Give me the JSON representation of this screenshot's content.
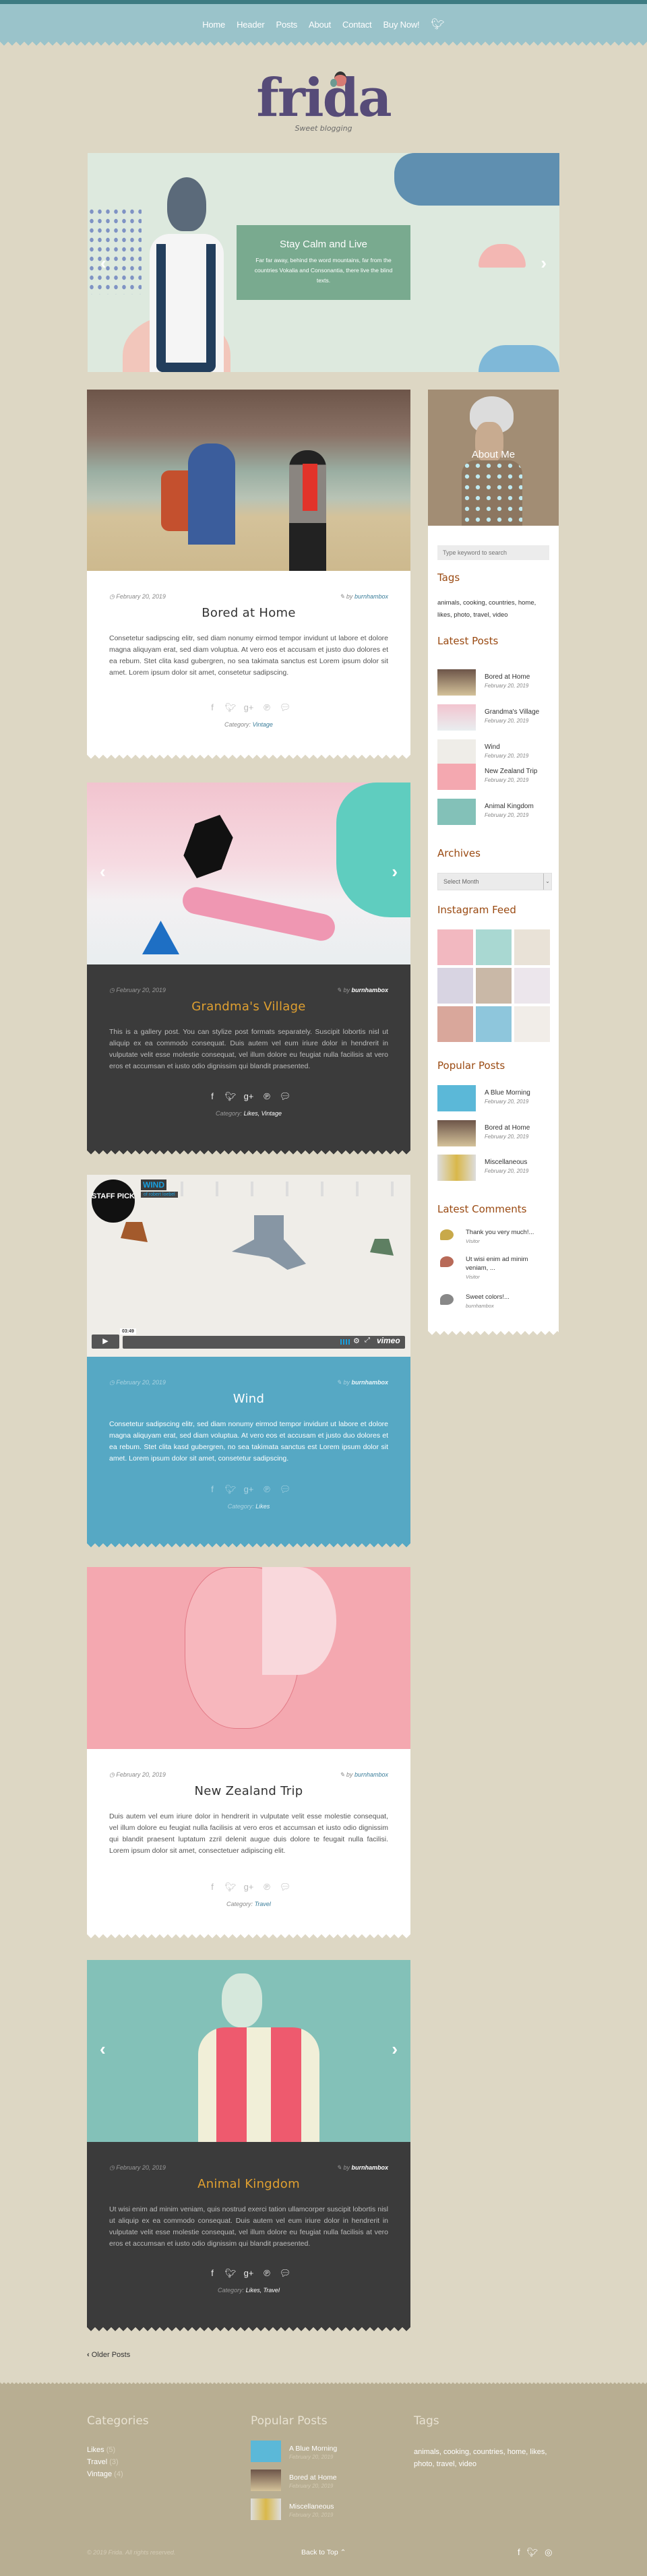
{
  "nav": {
    "items": [
      "Home",
      "Header",
      "Posts",
      "About",
      "Contact",
      "Buy Now!"
    ],
    "social_icon": "twitter-icon"
  },
  "logo": {
    "text": "frida",
    "tagline": "Sweet blogging"
  },
  "hero": {
    "title": "Stay Calm and Live",
    "text": "Far far away, behind the word mountains, far from the countries Vokalia and Consonantia, there live the blind texts.",
    "prev_icon": "chevron-left-icon",
    "next_icon": "chevron-right-icon"
  },
  "colors": {
    "background": "#ddd7c4",
    "nav": "#9ac3ca",
    "dark_card": "#3b3b3b",
    "blue_card": "#56a8c4",
    "accent_gold": "#e0a030",
    "sidebar_heading": "#9a4a12",
    "footer": "#b8ae92",
    "link": "#3a7d9a"
  },
  "posts": [
    {
      "date": "February 20, 2019",
      "by": "by",
      "author": "burnhambox",
      "title": "Bored at Home",
      "text": "Consetetur sadipscing elitr, sed diam nonumy eirmod tempor invidunt ut labore et dolore magna aliquyam erat, sed diam voluptua. At vero eos et accusam et justo duo dolores et ea rebum. Stet clita kasd gubergren, no sea takimata sanctus est Lorem ipsum dolor sit amet. Lorem ipsum dolor sit amet, consetetur sadipscing.",
      "category_label": "Category:",
      "categories": "Vintage"
    },
    {
      "date": "February 20, 2019",
      "by": "by",
      "author": "burnhambox",
      "title": "Grandma's Village",
      "text": "This is a gallery post. You can stylize post formats separately. Suscipit lobortis nisl ut aliquip ex ea commodo consequat. Duis autem vel eum iriure dolor in hendrerit in vulputate velit esse molestie consequat, vel illum dolore eu feugiat nulla facilisis at vero eros et accumsan et iusto odio dignissim qui blandit praesented.",
      "category_label": "Category:",
      "categories": "Likes, Vintage"
    },
    {
      "date": "February 20, 2019",
      "by": "by",
      "author": "burnhambox",
      "title": "Wind",
      "text": "Consetetur sadipscing elitr, sed diam nonumy eirmod tempor invidunt ut labore et dolore magna aliquyam erat, sed diam voluptua. At vero eos et accusam et justo duo dolores et ea rebum. Stet clita kasd gubergren, no sea takimata sanctus est Lorem ipsum dolor sit amet. Lorem ipsum dolor sit amet, consetetur sadipscing.",
      "category_label": "Category:",
      "categories": "Likes",
      "video": {
        "badge": "STAFF PICK",
        "label": "WIND",
        "sublabel": "of robert loebel",
        "time": "03:49",
        "brand": "vimeo"
      }
    },
    {
      "date": "February 20, 2019",
      "by": "by",
      "author": "burnhambox",
      "title": "New Zealand Trip",
      "text": "Duis autem vel eum iriure dolor in hendrerit in vulputate velit esse molestie consequat, vel illum dolore eu feugiat nulla facilisis at vero eros et accumsan et iusto odio dignissim qui blandit praesent luptatum zzril delenit augue duis dolore te feugait nulla facilisi. Lorem ipsum dolor sit amet, consectetuer adipiscing elit.",
      "category_label": "Category:",
      "categories": "Travel"
    },
    {
      "date": "February 20, 2019",
      "by": "by",
      "author": "burnhambox",
      "title": "Animal Kingdom",
      "text": "Ut wisi enim ad minim veniam, quis nostrud exerci tation ullamcorper suscipit lobortis nisl ut aliquip ex ea commodo consequat. Duis autem vel eum iriure dolor in hendrerit in vulputate velit esse molestie consequat, vel illum dolore eu feugiat nulla facilisis at vero eros et accumsan et iusto odio dignissim qui blandit praesented.",
      "category_label": "Category:",
      "categories": "Likes, Travel"
    }
  ],
  "pagination": {
    "older": "Older Posts"
  },
  "sidebar": {
    "about": "About Me",
    "search_placeholder": "Type keyword to search",
    "tags_title": "Tags",
    "tags": "animals, cooking, countries, home, likes, photo, travel, video",
    "latest_title": "Latest Posts",
    "latest": [
      {
        "title": "Bored at Home",
        "date": "February 20, 2019"
      },
      {
        "title": "Grandma's Village",
        "date": "February 20, 2019"
      },
      {
        "title": "Wind",
        "date": "February 20, 2019"
      },
      {
        "title": "New Zealand Trip",
        "date": "February 20, 2019"
      },
      {
        "title": "Animal Kingdom",
        "date": "February 20, 2019"
      }
    ],
    "archives_title": "Archives",
    "archives_select": "Select Month",
    "instagram_title": "Instagram Feed",
    "popular_title": "Popular Posts",
    "popular": [
      {
        "title": "A Blue Morning",
        "date": "February 20, 2019"
      },
      {
        "title": "Bored at Home",
        "date": "February 20, 2019"
      },
      {
        "title": "Miscellaneous",
        "date": "February 20, 2019"
      }
    ],
    "comments_title": "Latest Comments",
    "comments": [
      {
        "text": "Thank you very much!...",
        "author": "Visitor"
      },
      {
        "text": "Ut wisi enim ad minim veniam, ...",
        "author": "Visitor"
      },
      {
        "text": "Sweet colors!...",
        "author": "burnhambox"
      }
    ]
  },
  "footer": {
    "categories_title": "Categories",
    "categories": [
      {
        "name": "Likes",
        "count": "(5)"
      },
      {
        "name": "Travel",
        "count": "(3)"
      },
      {
        "name": "Vintage",
        "count": "(4)"
      }
    ],
    "popular_title": "Popular Posts",
    "popular": [
      {
        "title": "A Blue Morning",
        "date": "February 20, 2019"
      },
      {
        "title": "Bored at Home",
        "date": "February 20, 2019"
      },
      {
        "title": "Miscellaneous",
        "date": "February 20, 2019"
      }
    ],
    "tags_title": "Tags",
    "tags": "animals, cooking, countries, home, likes, photo, travel, video",
    "copyright": "© 2019 Frida. All rights reserved.",
    "back_to_top": "Back to Top",
    "social_icons": [
      "facebook-icon",
      "twitter-icon",
      "dribbble-icon"
    ]
  }
}
